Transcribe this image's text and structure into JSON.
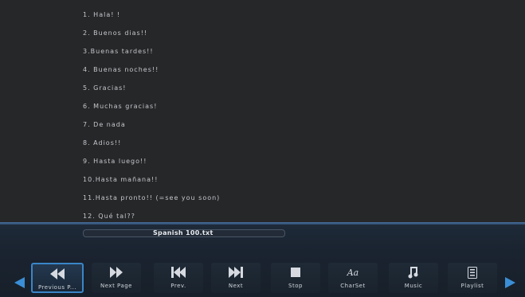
{
  "lines": [
    "1. Hala! !",
    "2. Buenos dias!!",
    "3.Buenas tardes!!",
    "4. Buenas noches!!",
    "5. Gracias!",
    "6. Muchas gracias!",
    "7. De nada",
    "8. Adios!!",
    "9. Hasta luego!!",
    "10.Hasta mañana!!",
    "11.Hasta pronto!! (=see you soon)",
    "12. Qué tal??"
  ],
  "file": {
    "name": "Spanish 100.txt"
  },
  "buttons": [
    {
      "label": "Previous P...",
      "icon": "rewind-icon",
      "selected": true
    },
    {
      "label": "Next Page",
      "icon": "fast-forward-icon",
      "selected": false
    },
    {
      "label": "Prev.",
      "icon": "skip-previous-icon",
      "selected": false
    },
    {
      "label": "Next",
      "icon": "skip-next-icon",
      "selected": false
    },
    {
      "label": "Stop",
      "icon": "stop-icon",
      "selected": false
    },
    {
      "label": "CharSet",
      "icon": "charset-icon",
      "selected": false
    },
    {
      "label": "Music",
      "icon": "music-note-icon",
      "selected": false
    },
    {
      "label": "Playlist",
      "icon": "playlist-icon",
      "selected": false
    }
  ],
  "icons": {
    "charset_glyph": "Aa"
  },
  "colors": {
    "accent": "#3a86c8",
    "arrow": "#3b8fd6"
  }
}
